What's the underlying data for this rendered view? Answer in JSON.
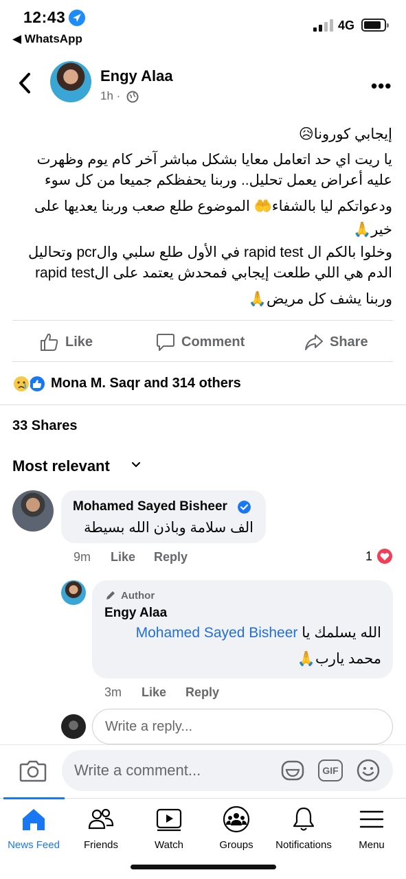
{
  "status_bar": {
    "time": "12:43",
    "back_app": "◀ WhatsApp",
    "network": "4G"
  },
  "post": {
    "author": "Engy Alaa",
    "time": "1h ·",
    "lines": [
      "إيجابي كورونا😥",
      "يا ريت اي حد اتعامل معايا بشكل مباشر آخر كام يوم وظهرت",
      "عليه أعراض يعمل تحليل.. وربنا يحفظكم جميعا من كل سوء",
      "ودعواتكم ليا بالشفاء🤲 الموضوع طلع صعب وربنا يعديها على",
      "خير🙏",
      "وخلوا بالكم ال rapid test في الأول طلع سلبي والpcr وتحاليل",
      "الدم هي اللي طلعت إيجابي فمحدش يعتمد على الrapid test",
      "وربنا يشف كل مريض🙏"
    ]
  },
  "actions": {
    "like": "Like",
    "comment": "Comment",
    "share": "Share"
  },
  "reactions_text": "Mona M. Saqr and 314 others",
  "shares_text": "33 Shares",
  "sort_label": "Most relevant",
  "comment": {
    "name": "Mohamed Sayed Bisheer",
    "text": "الف سلامة وباذن الله بسيطة",
    "time": "9m",
    "like": "Like",
    "reply": "Reply",
    "heart_count": "1"
  },
  "reply": {
    "badge": "Author",
    "name": "Engy Alaa",
    "mention": "Mohamed Sayed Bisheer",
    "text_before_mention": "الله يسلمك يا",
    "line2": "محمد يارب🙏",
    "time": "3m",
    "like": "Like",
    "reply": "Reply"
  },
  "reply_placeholder": "Write a reply...",
  "comment_placeholder": "Write a comment...",
  "gif_label": "GIF",
  "tabs": [
    {
      "label": "News Feed",
      "icon": "home-icon"
    },
    {
      "label": "Friends",
      "icon": "friends-icon"
    },
    {
      "label": "Watch",
      "icon": "watch-icon"
    },
    {
      "label": "Groups",
      "icon": "groups-icon"
    },
    {
      "label": "Notifications",
      "icon": "bell-icon"
    },
    {
      "label": "Menu",
      "icon": "menu-icon"
    }
  ],
  "colors": {
    "accent": "#1877f2",
    "link": "#216fdb",
    "heart": "#f33e58",
    "bubble": "#f0f2f5"
  }
}
